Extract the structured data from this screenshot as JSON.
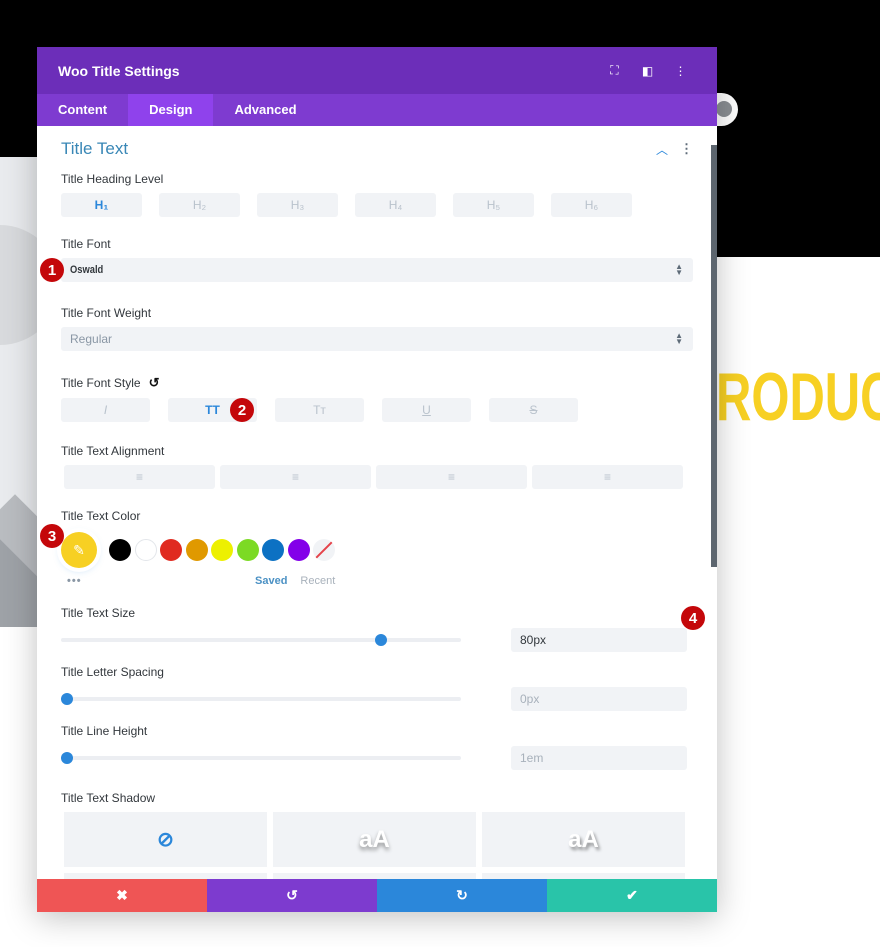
{
  "background": {
    "preview_title_fragment": "RODUC",
    "title_color": "#f7d023"
  },
  "modal": {
    "title": "Woo Title Settings",
    "header_icons": [
      "expand-icon",
      "split-view-icon",
      "more-options-icon"
    ],
    "header_color": "#6c2eb9",
    "tabs": [
      {
        "label": "Content",
        "active": false
      },
      {
        "label": "Design",
        "active": true
      },
      {
        "label": "Advanced",
        "active": false
      }
    ],
    "section": {
      "title": "Title Text",
      "heading_level": {
        "label": "Title Heading Level",
        "options": [
          "H₁",
          "H₂",
          "H₃",
          "H₄",
          "H₅",
          "H₆"
        ],
        "selected": "H₁"
      },
      "font": {
        "label": "Title Font",
        "value": "Oswald"
      },
      "font_weight": {
        "label": "Title Font Weight",
        "value": "Regular"
      },
      "font_style": {
        "label": "Title Font Style",
        "options": [
          "I",
          "TT",
          "Tт",
          "U",
          "S"
        ],
        "active": "TT"
      },
      "alignment": {
        "label": "Title Text Alignment",
        "options": [
          "left",
          "center",
          "right",
          "justify"
        ]
      },
      "text_color": {
        "label": "Title Text Color",
        "current": "#f7d023",
        "swatches": [
          "#000000",
          "#ffffff",
          "#e02b20",
          "#e09900",
          "#edf000",
          "#7cda24",
          "#0c71c3",
          "#8300e9"
        ],
        "saved_label": "Saved",
        "recent_label": "Recent"
      },
      "text_size": {
        "label": "Title Text Size",
        "value": "80px",
        "slider_fraction": 0.8
      },
      "letter_spacing": {
        "label": "Title Letter Spacing",
        "value": "0px",
        "slider_fraction": 0.0
      },
      "line_height": {
        "label": "Title Line Height",
        "value": "1em",
        "slider_fraction": 0.0
      },
      "text_shadow": {
        "label": "Title Text Shadow",
        "presets": [
          "none",
          "aA",
          "aA"
        ]
      }
    },
    "footer": {
      "cancel": "✖",
      "undo": "↺",
      "redo": "↻",
      "save": "✔"
    }
  },
  "annotations": [
    "1",
    "2",
    "3",
    "4"
  ]
}
